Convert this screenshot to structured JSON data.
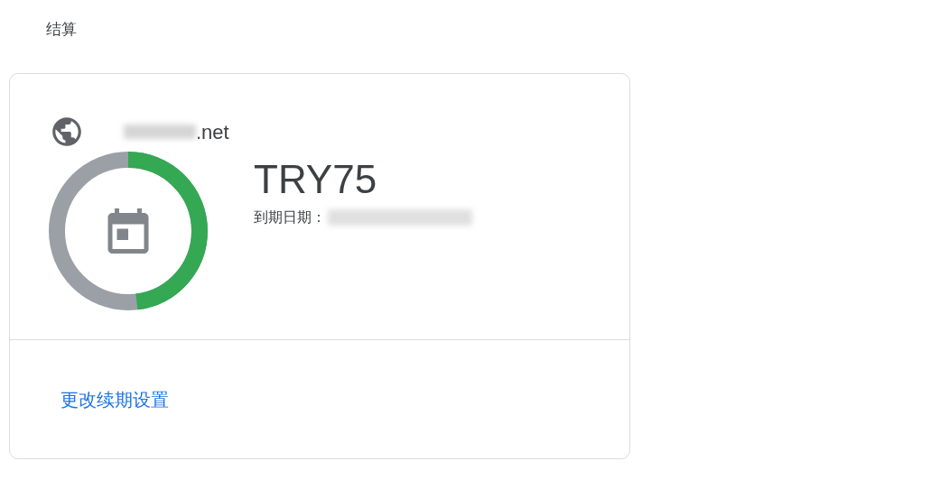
{
  "section_title": "结算",
  "domain": {
    "name": ".net"
  },
  "plan": {
    "name": "TRY75",
    "expiry_label": "到期日期：",
    "level": 0.48
  },
  "link": "更改续期设置"
}
